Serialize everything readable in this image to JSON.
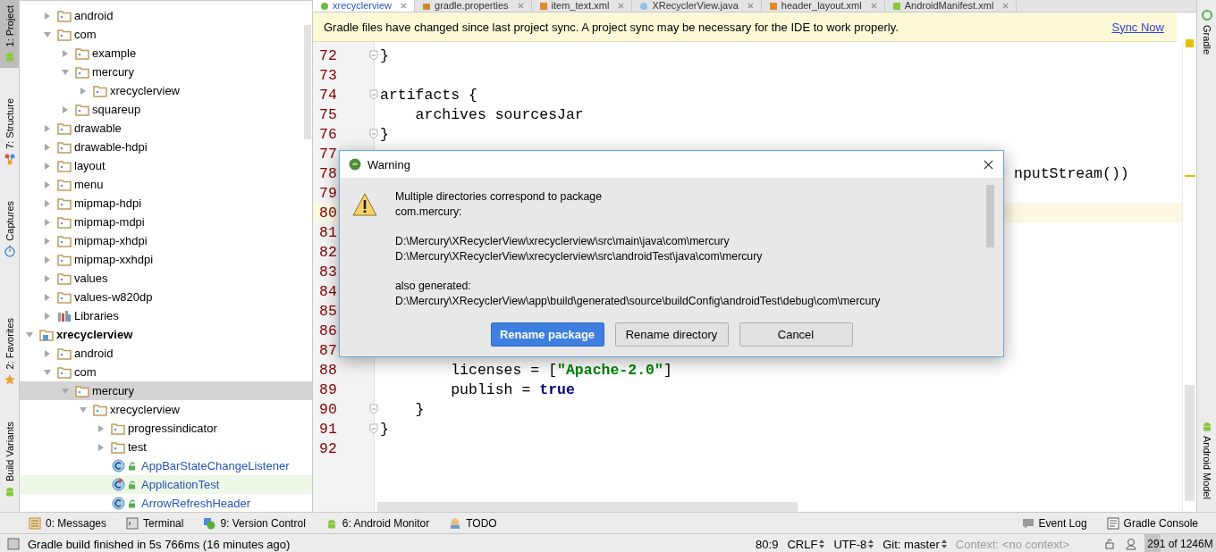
{
  "left_tools_top": [
    {
      "label": "1: Project",
      "kind": "android",
      "selected": true
    },
    {
      "label": "7: Structure",
      "kind": "structure",
      "selected": false
    },
    {
      "label": "Captures",
      "kind": "captures",
      "selected": false
    }
  ],
  "left_tools_bottom": [
    {
      "label": "2: Favorites",
      "kind": "star",
      "selected": false
    },
    {
      "label": "Build Variants",
      "kind": "android",
      "selected": false
    }
  ],
  "tree_top": [
    {
      "label": "android",
      "kind": "package",
      "expanded": false,
      "selected": false
    },
    {
      "label": "com",
      "kind": "package",
      "expanded": true,
      "selected": false,
      "children": [
        {
          "label": "example",
          "kind": "package",
          "expanded": false,
          "selected": false
        },
        {
          "label": "mercury",
          "kind": "package",
          "expanded": true,
          "selected": false,
          "children": [
            {
              "label": "xrecyclerview",
              "kind": "package",
              "expanded": false,
              "selected": false
            }
          ]
        },
        {
          "label": "squareup",
          "kind": "package",
          "expanded": false,
          "selected": false
        }
      ]
    },
    {
      "label": "drawable",
      "kind": "package",
      "expanded": false,
      "selected": false
    },
    {
      "label": "drawable-hdpi",
      "kind": "package",
      "expanded": false,
      "selected": false
    },
    {
      "label": "layout",
      "kind": "package",
      "expanded": false,
      "selected": false
    },
    {
      "label": "menu",
      "kind": "package",
      "expanded": false,
      "selected": false
    },
    {
      "label": "mipmap-hdpi",
      "kind": "package",
      "expanded": false,
      "selected": false
    },
    {
      "label": "mipmap-mdpi",
      "kind": "package",
      "expanded": false,
      "selected": false
    },
    {
      "label": "mipmap-xhdpi",
      "kind": "package",
      "expanded": false,
      "selected": false
    },
    {
      "label": "mipmap-xxhdpi",
      "kind": "package",
      "expanded": false,
      "selected": false
    },
    {
      "label": "values",
      "kind": "package",
      "expanded": false,
      "selected": false
    },
    {
      "label": "values-w820dp",
      "kind": "package",
      "expanded": false,
      "selected": false
    },
    {
      "label": "Libraries",
      "kind": "library",
      "expanded": false,
      "selected": false
    }
  ],
  "tree": [
    {
      "label": "xrecyclerview",
      "kind": "module",
      "expanded": true,
      "selected": false,
      "children": [
        {
          "label": "android",
          "kind": "package",
          "expanded": false,
          "selected": false
        },
        {
          "label": "com",
          "kind": "package",
          "expanded": true,
          "selected": false,
          "children": [
            {
              "label": "mercury",
              "kind": "package",
              "expanded": true,
              "selected": true,
              "children": [
                {
                  "label": "xrecyclerview",
                  "kind": "package",
                  "expanded": true,
                  "selected": false,
                  "children": [
                    {
                      "label": "progressindicator",
                      "kind": "package",
                      "expanded": false,
                      "selected": false
                    },
                    {
                      "label": "test",
                      "kind": "package",
                      "expanded": false,
                      "selected": false
                    },
                    {
                      "label": "AppBarStateChangeListener",
                      "kind": "class",
                      "selected": false
                    },
                    {
                      "label": "ApplicationTest",
                      "kind": "test_class",
                      "selected": false
                    },
                    {
                      "label": "ArrowRefreshHeader",
                      "kind": "class",
                      "selected": false
                    }
                  ]
                }
              ]
            }
          ]
        }
      ]
    }
  ],
  "editor_tabs": [
    {
      "label": "xrecyclerview",
      "kind": "gradle",
      "selected": true
    },
    {
      "label": "gradle.properties",
      "kind": "properties",
      "selected": false
    },
    {
      "label": "item_text.xml",
      "kind": "xml",
      "selected": false
    },
    {
      "label": "XRecyclerView.java",
      "kind": "java",
      "selected": false
    },
    {
      "label": "header_layout.xml",
      "kind": "xml",
      "selected": false
    },
    {
      "label": "AndroidManifest.xml",
      "kind": "manifest",
      "selected": false
    }
  ],
  "banner": {
    "text": "Gradle files have changed since last project sync. A project sync may be necessary for the IDE to work properly.",
    "link": "Sync Now"
  },
  "code_lines": [
    {
      "number": "72",
      "fold": true,
      "current": false,
      "covered": false,
      "segments": [
        {
          "text": "}",
          "kind": "plain"
        }
      ]
    },
    {
      "number": "73",
      "fold": false,
      "current": false
    },
    {
      "number": "74",
      "fold": true,
      "current": false,
      "covered": false,
      "segments": [
        {
          "text": "artifacts {",
          "kind": "plain"
        }
      ]
    },
    {
      "number": "75",
      "fold": false,
      "current": false,
      "covered": false,
      "segments": [
        {
          "text": "    archives sourcesJar",
          "kind": "plain"
        }
      ]
    },
    {
      "number": "76",
      "fold": true,
      "current": false,
      "covered": false,
      "segments": [
        {
          "text": "}",
          "kind": "plain"
        }
      ]
    },
    {
      "number": "77",
      "fold": false,
      "current": false
    },
    {
      "number": "78",
      "fold": false,
      "current": false,
      "covered": true,
      "segments": [
        {
          "text": "nputStream())",
          "kind": "plain"
        }
      ]
    },
    {
      "number": "79",
      "fold": false,
      "current": false
    },
    {
      "number": "80",
      "fold": false,
      "current": true
    },
    {
      "number": "81",
      "fold": false,
      "current": false
    },
    {
      "number": "82",
      "fold": false,
      "current": false
    },
    {
      "number": "83",
      "fold": false,
      "current": false
    },
    {
      "number": "84",
      "fold": false,
      "current": false
    },
    {
      "number": "85",
      "fold": false,
      "current": false
    },
    {
      "number": "86",
      "fold": false,
      "current": false
    },
    {
      "number": "87",
      "fold": false,
      "current": false
    },
    {
      "number": "88",
      "fold": false,
      "current": false,
      "covered": false,
      "segments": [
        {
          "text": "        licenses = [",
          "kind": "plain"
        },
        {
          "text": "\"Apache-2.0\"",
          "kind": "string"
        },
        {
          "text": "]",
          "kind": "plain"
        }
      ]
    },
    {
      "number": "89",
      "fold": false,
      "current": false,
      "covered": false,
      "segments": [
        {
          "text": "        publish = ",
          "kind": "plain"
        },
        {
          "text": "true",
          "kind": "keyword"
        }
      ]
    },
    {
      "number": "90",
      "fold": true,
      "current": false,
      "covered": false,
      "segments": [
        {
          "text": "    }",
          "kind": "plain"
        }
      ]
    },
    {
      "number": "91",
      "fold": true,
      "current": false,
      "covered": false,
      "segments": [
        {
          "text": "}",
          "kind": "plain"
        }
      ]
    },
    {
      "number": "92",
      "fold": false,
      "current": false
    }
  ],
  "dialog": {
    "title": "Warning",
    "paragraphs": [
      [
        "Multiple directories correspond to package",
        "com.mercury:"
      ],
      [
        "D:\\Mercury\\XRecyclerView\\xrecyclerview\\src\\main\\java\\com\\mercury",
        "D:\\Mercury\\XRecyclerView\\xrecyclerview\\src\\androidTest\\java\\com\\mercury"
      ],
      [
        "also generated:",
        "D:\\Mercury\\XRecyclerView\\app\\build\\generated\\source\\buildConfig\\androidTest\\debug\\com\\mercury"
      ]
    ],
    "buttons": [
      {
        "label": "Rename package",
        "default": true
      },
      {
        "label": "Rename directory",
        "default": false
      },
      {
        "label": "Cancel",
        "default": false
      }
    ]
  },
  "right_tools_top": [
    {
      "label": "Gradle",
      "kind": "gradle"
    }
  ],
  "right_tools_bottom": [
    {
      "label": "Android Model",
      "kind": "android"
    }
  ],
  "bottom_tools_left": [
    {
      "label": "0: Messages",
      "kind": "messages"
    },
    {
      "label": "Terminal",
      "kind": "terminal"
    },
    {
      "label": "9: Version Control",
      "kind": "vcs"
    },
    {
      "label": "6: Android Monitor",
      "kind": "android"
    },
    {
      "label": "TODO",
      "kind": "todo"
    }
  ],
  "bottom_tools_right": [
    {
      "label": "Event Log",
      "kind": "event"
    },
    {
      "label": "Gradle Console",
      "kind": "console"
    }
  ],
  "status": {
    "message": "Gradle build finished in 5s 766ms (16 minutes ago)",
    "items": [
      {
        "text": "80:9",
        "kind": "plain"
      },
      {
        "text": "CRLF",
        "kind": "selector"
      },
      {
        "text": "UTF-8",
        "kind": "selector"
      },
      {
        "text": "Git: master",
        "kind": "selector"
      },
      {
        "text": "Context: <no context>",
        "kind": "muted"
      }
    ],
    "memory": {
      "text": "291 of 1246M",
      "level": 0.23
    }
  }
}
